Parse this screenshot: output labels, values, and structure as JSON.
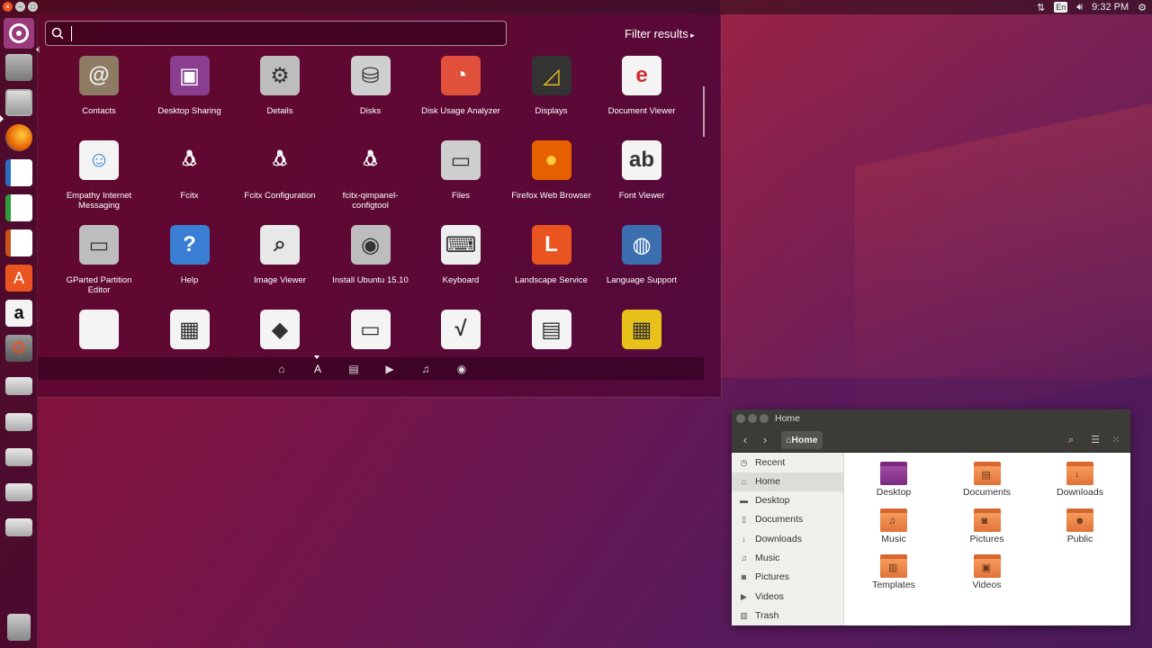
{
  "panel": {
    "time": "9:32 PM",
    "keyboard_layout": "En",
    "indicators": [
      "network-icon",
      "keyboard-icon",
      "volume-icon",
      "gear-icon"
    ]
  },
  "launcher": {
    "items": [
      "ubuntu-dash",
      "system-installer",
      "files",
      "firefox",
      "libreoffice-writer",
      "libreoffice-calc",
      "libreoffice-impress",
      "ubuntu-software",
      "amazon",
      "system-settings",
      "drive-1",
      "drive-2",
      "drive-3",
      "drive-4",
      "drive-5",
      "trash"
    ]
  },
  "dash": {
    "search_placeholder": "",
    "filter_label": "Filter results",
    "apps": [
      {
        "label": "Contacts",
        "icon": "contacts-icon"
      },
      {
        "label": "Desktop Sharing",
        "icon": "desktop-sharing-icon"
      },
      {
        "label": "Details",
        "icon": "details-icon"
      },
      {
        "label": "Disks",
        "icon": "disks-icon"
      },
      {
        "label": "Disk Usage Analyzer",
        "icon": "disk-usage-icon"
      },
      {
        "label": "Displays",
        "icon": "displays-icon"
      },
      {
        "label": "Document Viewer",
        "icon": "document-viewer-icon"
      },
      {
        "label": "Empathy Internet Messaging",
        "icon": "empathy-icon"
      },
      {
        "label": "Fcitx",
        "icon": "fcitx-icon"
      },
      {
        "label": "Fcitx Configuration",
        "icon": "fcitx-config-icon"
      },
      {
        "label": "fcitx-qimpanel-configtool",
        "icon": "fcitx-qimpanel-icon"
      },
      {
        "label": "Files",
        "icon": "files-icon"
      },
      {
        "label": "Firefox Web Browser",
        "icon": "firefox-icon"
      },
      {
        "label": "Font Viewer",
        "icon": "font-viewer-icon"
      },
      {
        "label": "GParted Partition Editor",
        "icon": "gparted-icon"
      },
      {
        "label": "Help",
        "icon": "help-icon"
      },
      {
        "label": "Image Viewer",
        "icon": "image-viewer-icon"
      },
      {
        "label": "Install Ubuntu 15.10",
        "icon": "install-ubuntu-icon"
      },
      {
        "label": "Keyboard",
        "icon": "keyboard-icon"
      },
      {
        "label": "Landscape Service",
        "icon": "landscape-icon"
      },
      {
        "label": "Language Support",
        "icon": "language-support-icon"
      },
      {
        "label": "",
        "icon": "libreoffice-icon"
      },
      {
        "label": "",
        "icon": "libreoffice-calc-icon"
      },
      {
        "label": "",
        "icon": "libreoffice-draw-icon"
      },
      {
        "label": "",
        "icon": "libreoffice-impress-icon"
      },
      {
        "label": "",
        "icon": "libreoffice-math-icon"
      },
      {
        "label": "",
        "icon": "libreoffice-writer-icon"
      },
      {
        "label": "",
        "icon": "mahjongg-icon"
      }
    ],
    "lenses": [
      "home-lens-icon",
      "applications-lens-icon",
      "files-lens-icon",
      "video-lens-icon",
      "music-lens-icon",
      "photo-lens-icon"
    ]
  },
  "file_manager": {
    "title": "Home",
    "breadcrumb": "Home",
    "sidebar": [
      "Recent",
      "Home",
      "Desktop",
      "Documents",
      "Downloads",
      "Music",
      "Pictures",
      "Videos",
      "Trash"
    ],
    "sidebar_icons": [
      "recent-icon",
      "home-icon",
      "desktop-icon",
      "documents-icon",
      "downloads-icon",
      "music-icon",
      "pictures-icon",
      "videos-icon",
      "trash-icon"
    ],
    "folders": [
      "Desktop",
      "Documents",
      "Downloads",
      "Music",
      "Pictures",
      "Public",
      "Templates",
      "Videos"
    ]
  },
  "colors": {
    "accent": "#e95420",
    "dash_bg": "#46002a",
    "folder": "#e1733b"
  }
}
